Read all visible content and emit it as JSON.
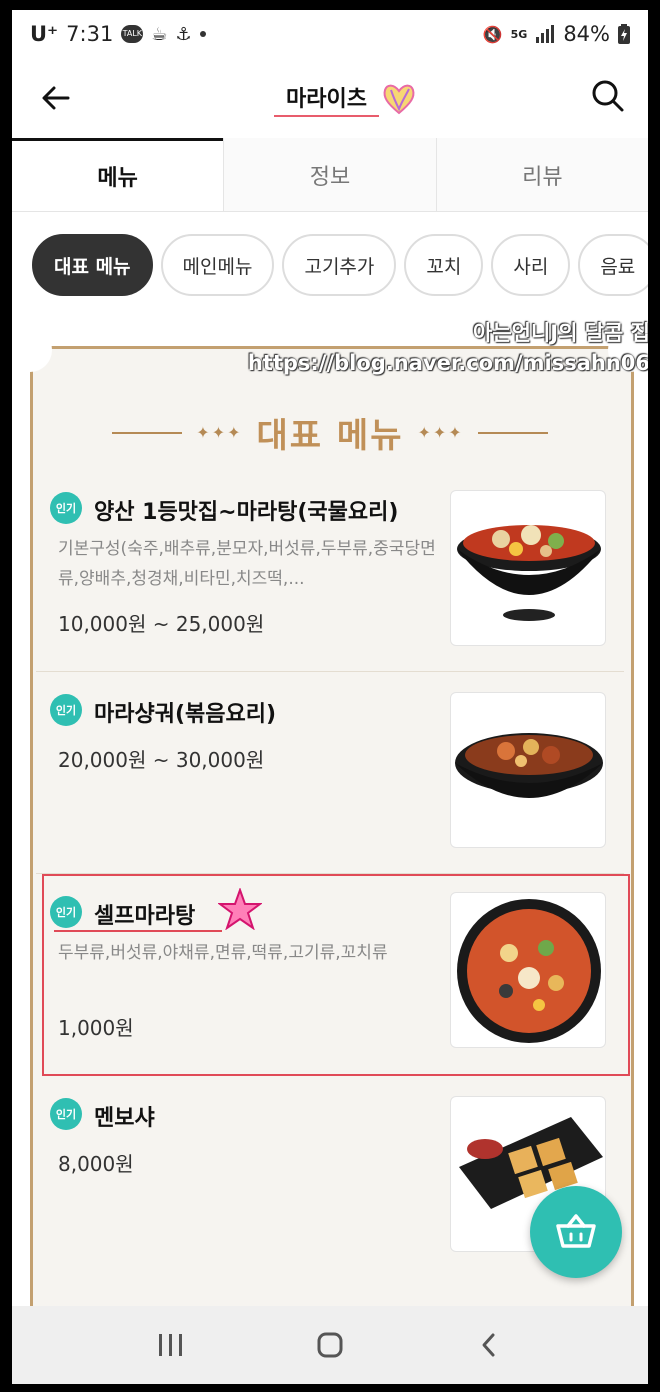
{
  "status_bar": {
    "carrier": "U⁺",
    "time": "7:31",
    "icons": [
      "talk-icon",
      "coffee-icon",
      "anchor-icon"
    ],
    "network": "5G",
    "battery": "84%"
  },
  "header": {
    "title": "마라이츠",
    "back_icon": "arrow-left-icon",
    "search_icon": "search-icon"
  },
  "tabs": [
    {
      "label": "메뉴",
      "active": true
    },
    {
      "label": "정보",
      "active": false
    },
    {
      "label": "리뷰",
      "active": false
    }
  ],
  "categories": [
    {
      "label": "대표 메뉴",
      "active": true
    },
    {
      "label": "메인메뉴",
      "active": false
    },
    {
      "label": "고기추가",
      "active": false
    },
    {
      "label": "꼬치",
      "active": false
    },
    {
      "label": "사리",
      "active": false
    },
    {
      "label": "음료",
      "active": false
    }
  ],
  "watermark": {
    "line1": "아는언니J의 달콤 집",
    "line2": "https://blog.naver.com/missahn06"
  },
  "section": {
    "title": "대표 메뉴"
  },
  "items": [
    {
      "badge": "인기",
      "name": "양산 1등맛집~마라탕(국물요리)",
      "desc": "기본구성(숙주,배추류,분모자,버섯류,두부류,중국당면류,양배추,청경채,비타민,치즈떡,...",
      "price": "10,000원 ~ 25,000원"
    },
    {
      "badge": "인기",
      "name": "마라샹궈(볶음요리)",
      "desc": "",
      "price": "20,000원 ~ 30,000원"
    },
    {
      "badge": "인기",
      "name": "셀프마라탕",
      "desc": "두부류,버섯류,야채류,면류,떡류,고기류,꼬치류",
      "price": "1,000원"
    },
    {
      "badge": "인기",
      "name": "멘보샤",
      "desc": "",
      "price": "8,000원"
    }
  ],
  "colors": {
    "accent": "#2fbfb2",
    "board_border": "#c3a070",
    "highlight": "#e04a57"
  }
}
